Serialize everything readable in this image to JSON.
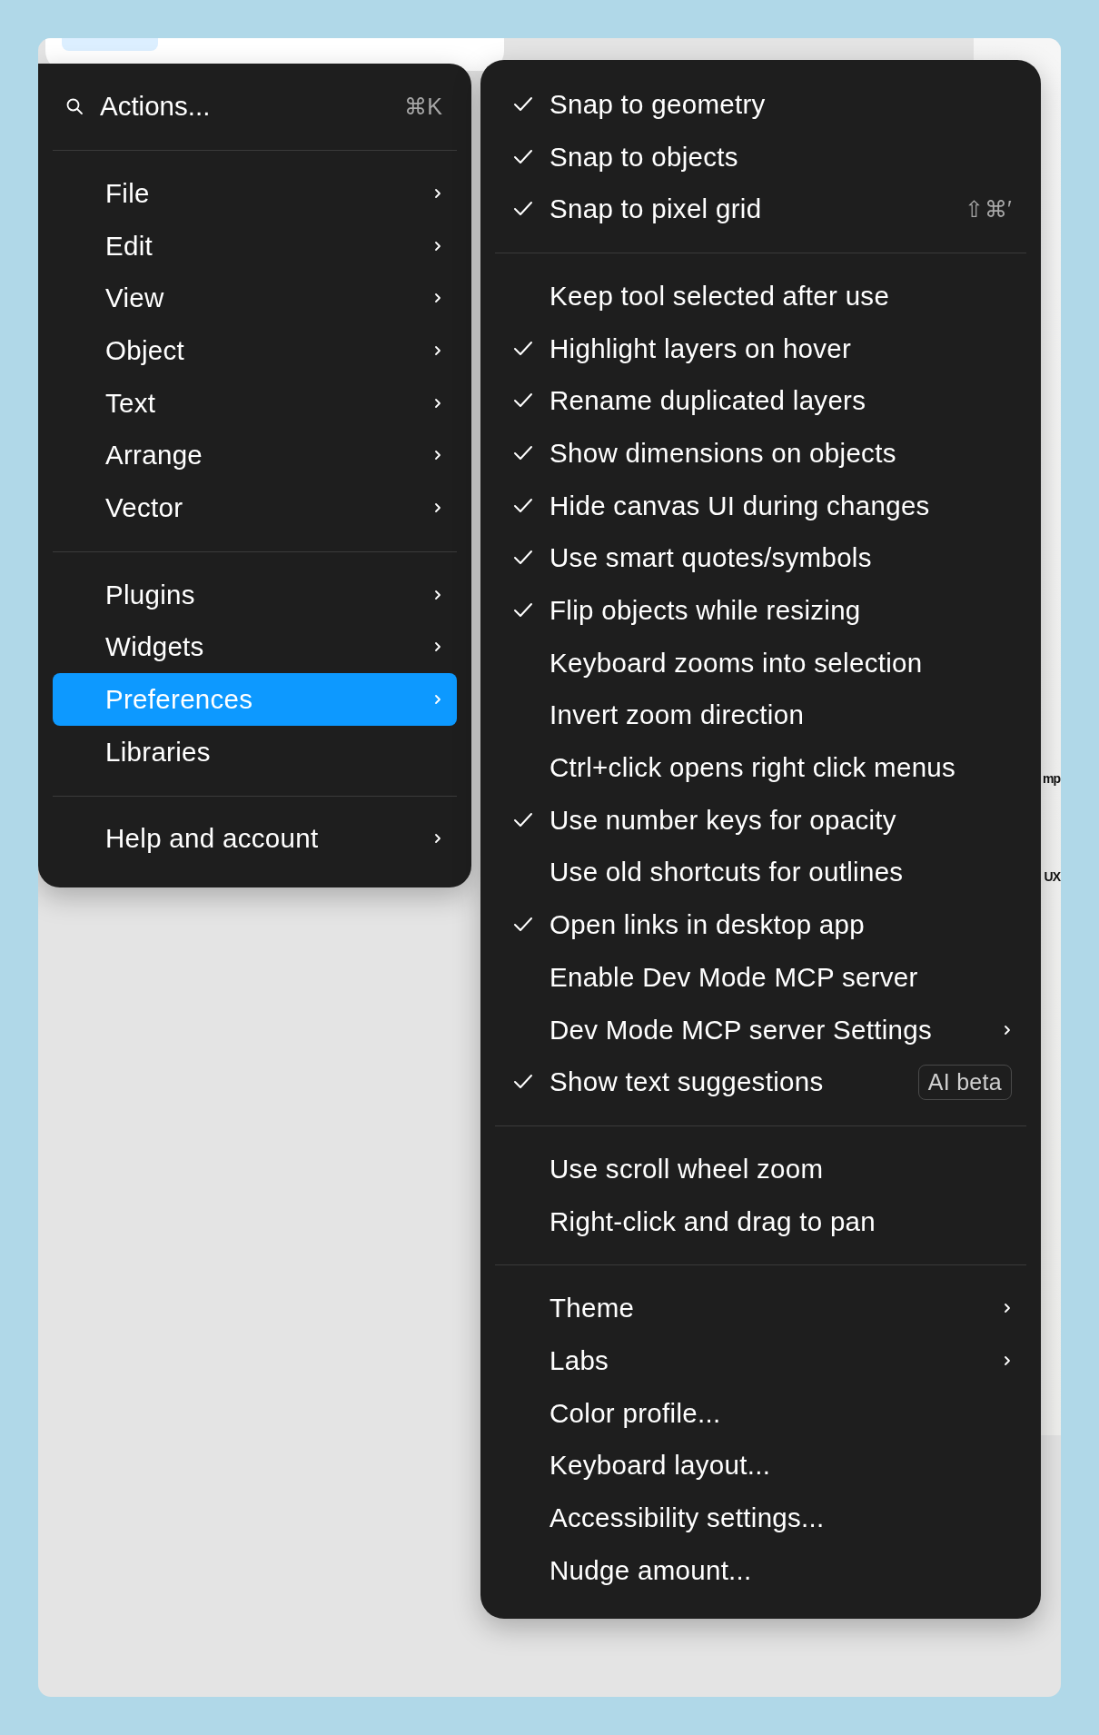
{
  "background": {
    "fragments": [
      "mp",
      "UX"
    ]
  },
  "search": {
    "placeholder": "Actions...",
    "shortcut": "⌘K"
  },
  "main_menu": [
    [
      {
        "label": "File",
        "has_submenu": true,
        "selected": false
      },
      {
        "label": "Edit",
        "has_submenu": true,
        "selected": false
      },
      {
        "label": "View",
        "has_submenu": true,
        "selected": false
      },
      {
        "label": "Object",
        "has_submenu": true,
        "selected": false
      },
      {
        "label": "Text",
        "has_submenu": true,
        "selected": false
      },
      {
        "label": "Arrange",
        "has_submenu": true,
        "selected": false
      },
      {
        "label": "Vector",
        "has_submenu": true,
        "selected": false
      }
    ],
    [
      {
        "label": "Plugins",
        "has_submenu": true,
        "selected": false
      },
      {
        "label": "Widgets",
        "has_submenu": true,
        "selected": false
      },
      {
        "label": "Preferences",
        "has_submenu": true,
        "selected": true
      },
      {
        "label": "Libraries",
        "has_submenu": false,
        "selected": false
      }
    ],
    [
      {
        "label": "Help and account",
        "has_submenu": true,
        "selected": false
      }
    ]
  ],
  "preferences_menu": [
    [
      {
        "label": "Snap to geometry",
        "checked": true,
        "has_submenu": false
      },
      {
        "label": "Snap to objects",
        "checked": true,
        "has_submenu": false
      },
      {
        "label": "Snap to pixel grid",
        "checked": true,
        "has_submenu": false,
        "shortcut": "⇧⌘′"
      }
    ],
    [
      {
        "label": "Keep tool selected after use",
        "checked": false,
        "has_submenu": false
      },
      {
        "label": "Highlight layers on hover",
        "checked": true,
        "has_submenu": false
      },
      {
        "label": "Rename duplicated layers",
        "checked": true,
        "has_submenu": false
      },
      {
        "label": "Show dimensions on objects",
        "checked": true,
        "has_submenu": false
      },
      {
        "label": "Hide canvas UI during changes",
        "checked": true,
        "has_submenu": false
      },
      {
        "label": "Use smart quotes/symbols",
        "checked": true,
        "has_submenu": false
      },
      {
        "label": "Flip objects while resizing",
        "checked": true,
        "has_submenu": false
      },
      {
        "label": "Keyboard zooms into selection",
        "checked": false,
        "has_submenu": false
      },
      {
        "label": "Invert zoom direction",
        "checked": false,
        "has_submenu": false
      },
      {
        "label": "Ctrl+click opens right click menus",
        "checked": false,
        "has_submenu": false
      },
      {
        "label": "Use number keys for opacity",
        "checked": true,
        "has_submenu": false
      },
      {
        "label": "Use old shortcuts for outlines",
        "checked": false,
        "has_submenu": false
      },
      {
        "label": "Open links in desktop app",
        "checked": true,
        "has_submenu": false
      },
      {
        "label": "Enable Dev Mode MCP server",
        "checked": false,
        "has_submenu": false
      },
      {
        "label": "Dev Mode MCP server Settings",
        "checked": false,
        "has_submenu": true
      },
      {
        "label": "Show text suggestions",
        "checked": true,
        "has_submenu": false,
        "badge": "AI beta"
      }
    ],
    [
      {
        "label": "Use scroll wheel zoom",
        "checked": false,
        "has_submenu": false
      },
      {
        "label": "Right-click and drag to pan",
        "checked": false,
        "has_submenu": false
      }
    ],
    [
      {
        "label": "Theme",
        "checked": false,
        "has_submenu": true
      },
      {
        "label": "Labs",
        "checked": false,
        "has_submenu": true
      },
      {
        "label": "Color profile...",
        "checked": false,
        "has_submenu": false
      },
      {
        "label": "Keyboard layout...",
        "checked": false,
        "has_submenu": false
      },
      {
        "label": "Accessibility settings...",
        "checked": false,
        "has_submenu": false
      },
      {
        "label": "Nudge amount...",
        "checked": false,
        "has_submenu": false
      }
    ]
  ]
}
